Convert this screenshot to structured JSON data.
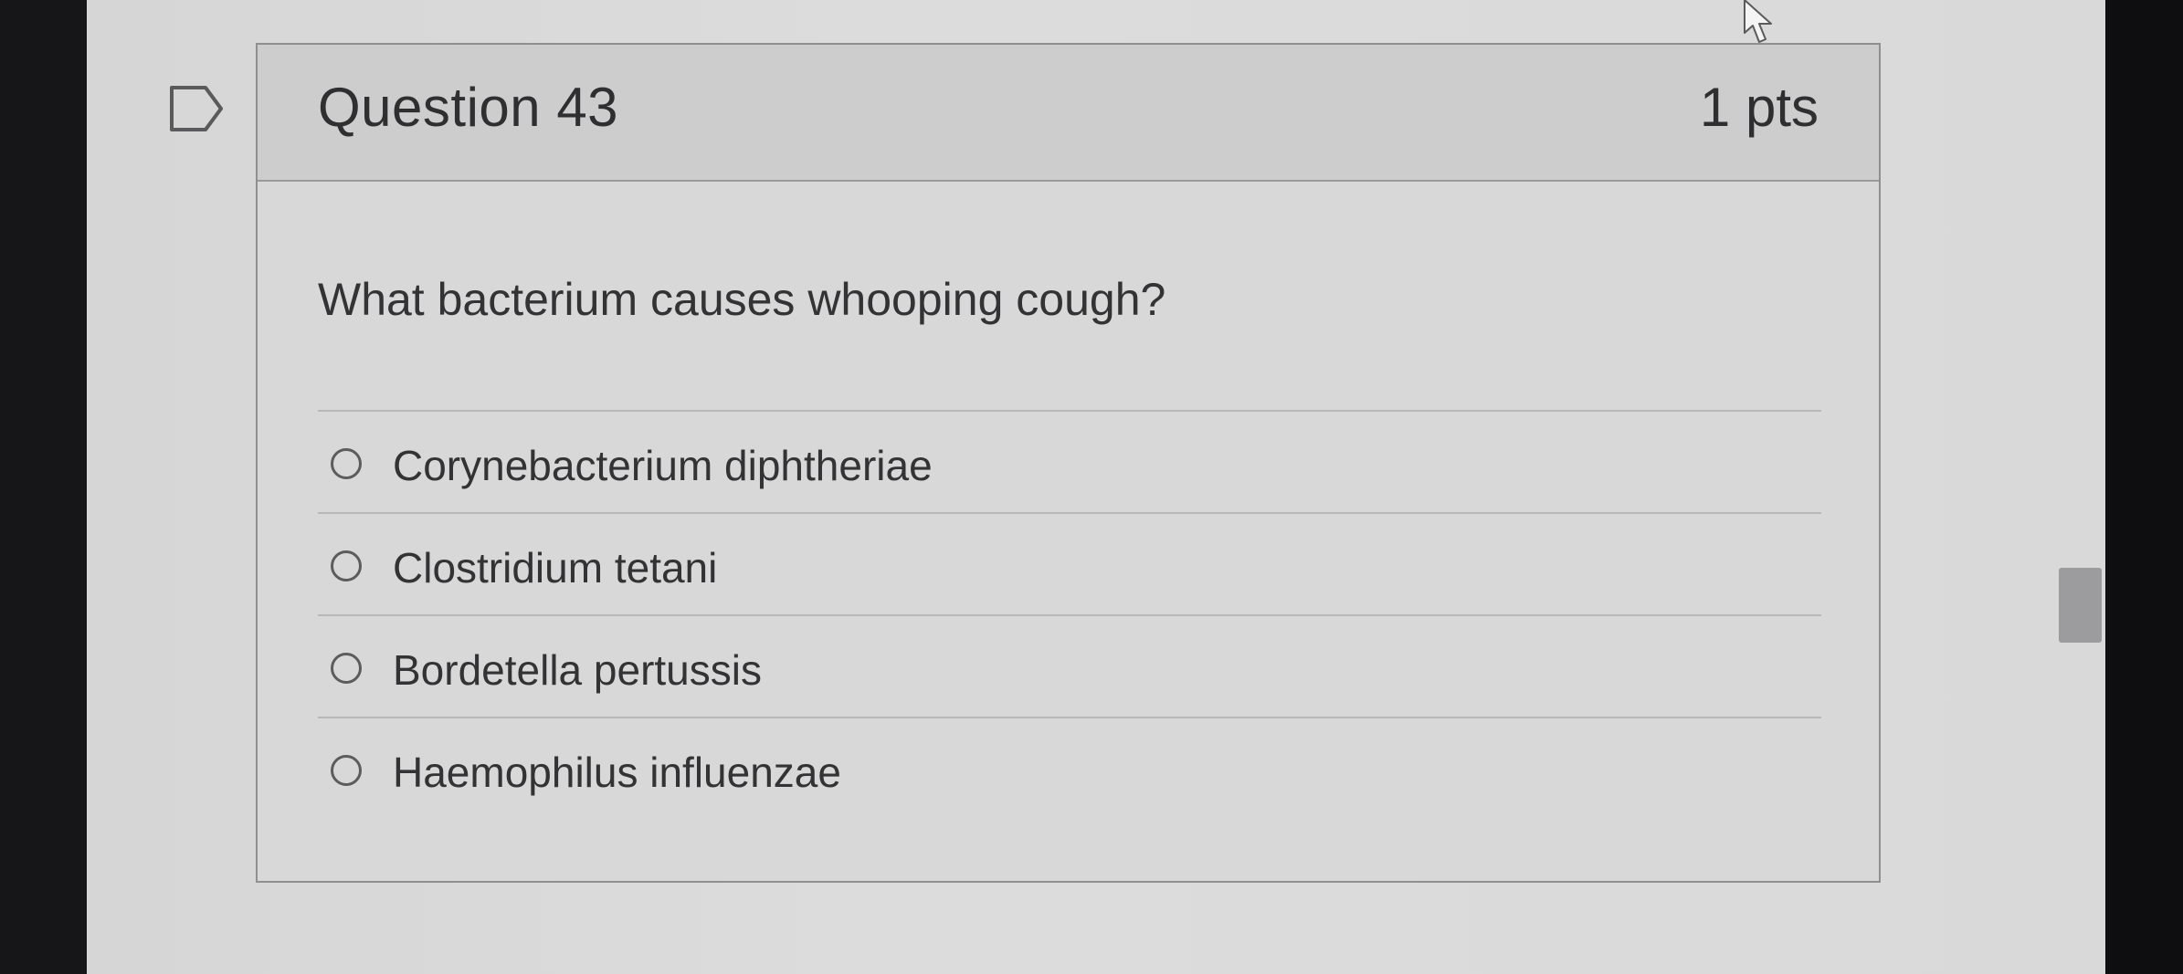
{
  "question": {
    "title": "Question 43",
    "points": "1 pts",
    "prompt": "What bacterium causes whooping cough?",
    "flag_icon": "flag-icon",
    "answers": [
      {
        "label": "Corynebacterium diphtheriae",
        "selected": false
      },
      {
        "label": "Clostridium tetani",
        "selected": false
      },
      {
        "label": "Bordetella pertussis",
        "selected": false
      },
      {
        "label": "Haemophilus influenzae",
        "selected": false
      }
    ]
  },
  "colors": {
    "text": "#333335",
    "border": "#8f8f8f",
    "header_bg": "#cdcdcd"
  }
}
